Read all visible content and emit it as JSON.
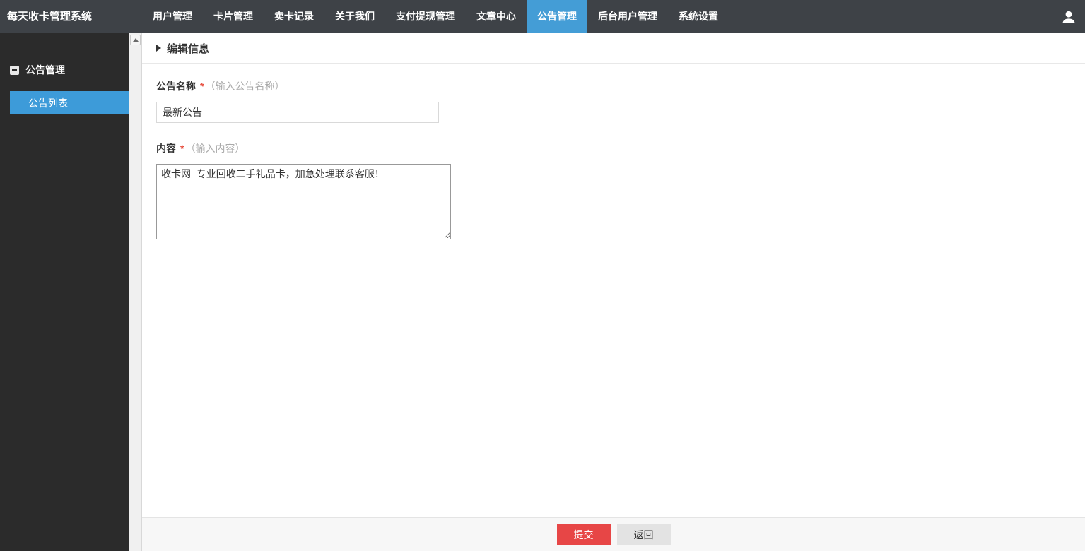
{
  "app": {
    "title": "每天收卡管理系统"
  },
  "nav": {
    "items": [
      {
        "label": "用户管理",
        "active": false
      },
      {
        "label": "卡片管理",
        "active": false
      },
      {
        "label": "卖卡记录",
        "active": false
      },
      {
        "label": "关于我们",
        "active": false
      },
      {
        "label": "支付提现管理",
        "active": false
      },
      {
        "label": "文章中心",
        "active": false
      },
      {
        "label": "公告管理",
        "active": true
      },
      {
        "label": "后台用户管理",
        "active": false
      },
      {
        "label": "系统设置",
        "active": false
      }
    ],
    "user_icon": "user-icon"
  },
  "sidebar": {
    "group": {
      "label": "公告管理",
      "icon": "minus-square-icon"
    },
    "items": [
      {
        "label": "公告列表",
        "active": true
      }
    ]
  },
  "scrollbar": {
    "up_icon": "triangle-up-icon"
  },
  "main": {
    "header": {
      "title": "编辑信息",
      "icon": "caret-right-icon"
    },
    "form": {
      "name": {
        "label": "公告名称",
        "required_mark": "*",
        "hint": "（输入公告名称）",
        "value": "最新公告"
      },
      "content": {
        "label": "内容",
        "required_mark": "*",
        "hint": "（输入内容）",
        "value": "收卡网_专业回收二手礼品卡，加急处理联系客服！"
      }
    },
    "footer": {
      "submit_label": "提交",
      "back_label": "返回"
    }
  },
  "colors": {
    "nav_bg": "#3e4247",
    "nav_active_blue": "#449dd6",
    "sidebar_bg": "#2b2b2b",
    "sidebar_active_blue": "#3d9bd9",
    "submit_red": "#e74646",
    "back_gray": "#e3e3e3",
    "required_red": "#e74c3c",
    "hint_gray": "#aaaaaa"
  }
}
